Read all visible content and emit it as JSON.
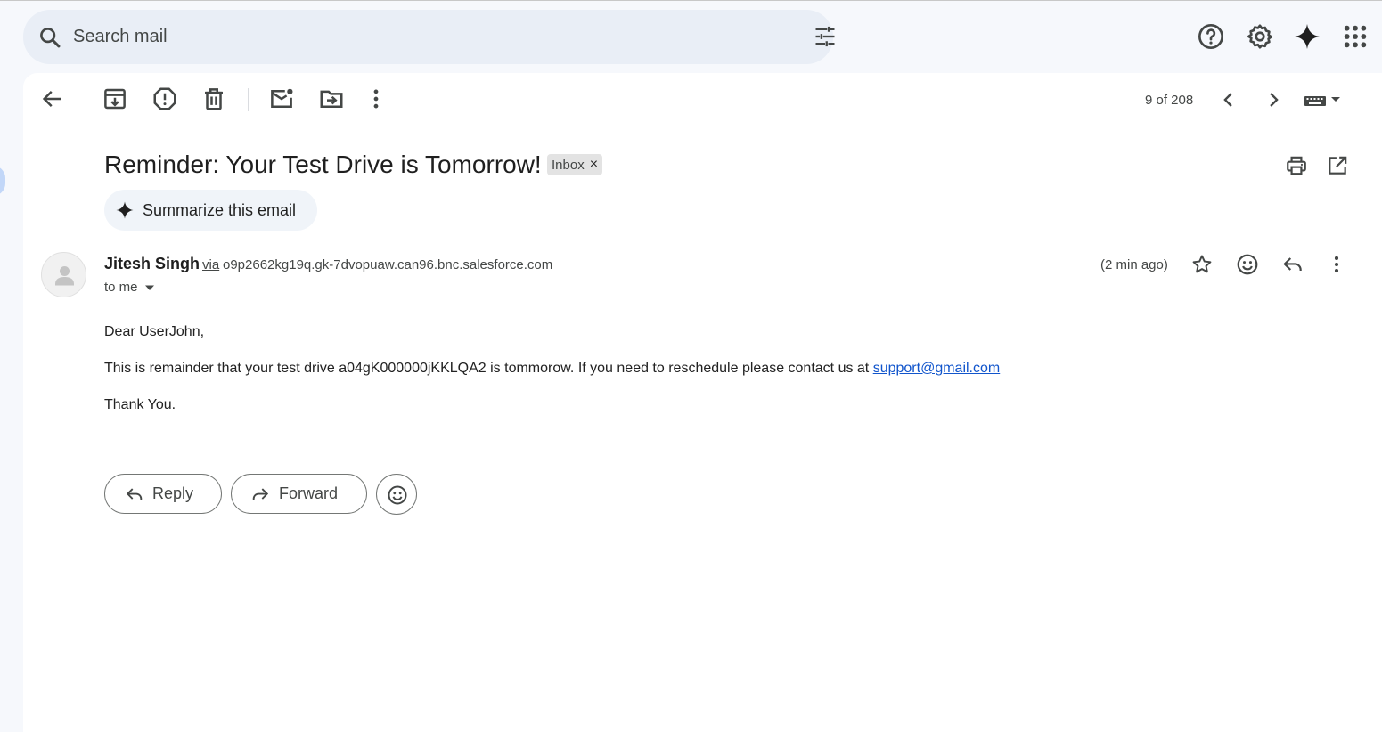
{
  "search": {
    "placeholder": "Search mail",
    "search_icon": "search-icon",
    "filter_icon": "tune-icon"
  },
  "top_icons": [
    "help-icon",
    "settings-icon",
    "gemini-icon",
    "apps-icon"
  ],
  "toolbar": {
    "back": "arrow-left-icon",
    "archive": "archive-icon",
    "spam": "report-spam-icon",
    "delete": "trash-icon",
    "mark_unread": "mark-unread-icon",
    "move_to": "move-to-icon",
    "more": "more-vert-icon",
    "pager_text": "9 of 208",
    "prev": "chevron-left-icon",
    "next": "chevron-right-icon",
    "input_tools": "keyboard-icon"
  },
  "message": {
    "subject": "Reminder: Your Test Drive is Tomorrow!",
    "label": "Inbox",
    "label_close": "×",
    "summarize_label": "Summarize this email",
    "print_icon": "print-icon",
    "open_new_window_icon": "open-in-new-icon",
    "sender_name": "Jitesh Singh",
    "via": "via",
    "sender_address": "o9p2662kg19q.gk-7dvopuaw.can96.bnc.salesforce.com",
    "to": "to me",
    "time": "(2 min ago)",
    "body": {
      "greeting": "Dear UserJohn,",
      "line1_prefix": "This is remainder that your test drive a04gK000000jKKLQA2 is tommorow. If you need to reschedule please contact us at ",
      "line1_link": "support@gmail.com",
      "signoff": "Thank You."
    }
  },
  "actions": {
    "reply_label": "Reply",
    "forward_label": "Forward"
  },
  "colors": {
    "page_bg": "#f6f8fc",
    "search_bg": "#e9eef6",
    "link": "#1155cc",
    "chip_bg": "#e3e3e3",
    "summarize_bg": "#f0f4f9"
  }
}
